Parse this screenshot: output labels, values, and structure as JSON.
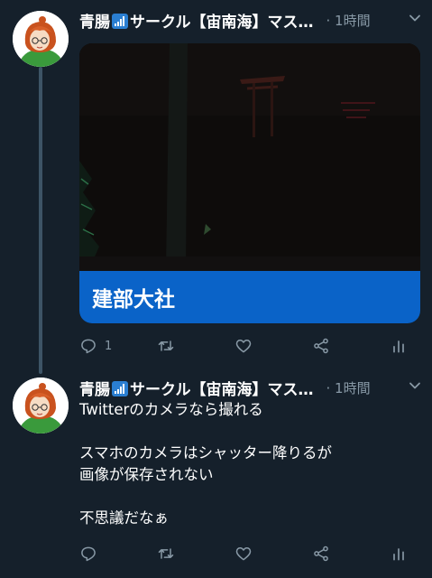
{
  "colors": {
    "background": "#15202b",
    "caption_bar": "#0a63c8",
    "secondary_text": "#8899a6",
    "thread_line": "#3d5466"
  },
  "tweets": [
    {
      "author_name_part1": "青腸",
      "author_name_part2": "サークル【宙南海】マス…",
      "time": "· 1時間",
      "media_caption": "建部大社",
      "reply_count": "1"
    },
    {
      "author_name_part1": "青腸",
      "author_name_part2": "サークル【宙南海】マス…",
      "time": "· 1時間",
      "text_lines": [
        "Twitterのカメラなら撮れる",
        "",
        "スマホのカメラはシャッター降りるが",
        "画像が保存されない",
        "",
        "不思議だなぁ"
      ]
    }
  ],
  "icons": {
    "signal": "antenna-bars-icon",
    "menu": "chevron-down-icon",
    "reply": "reply-icon",
    "retweet": "retweet-icon",
    "like": "heart-icon",
    "share": "share-icon",
    "analytics": "analytics-icon"
  }
}
